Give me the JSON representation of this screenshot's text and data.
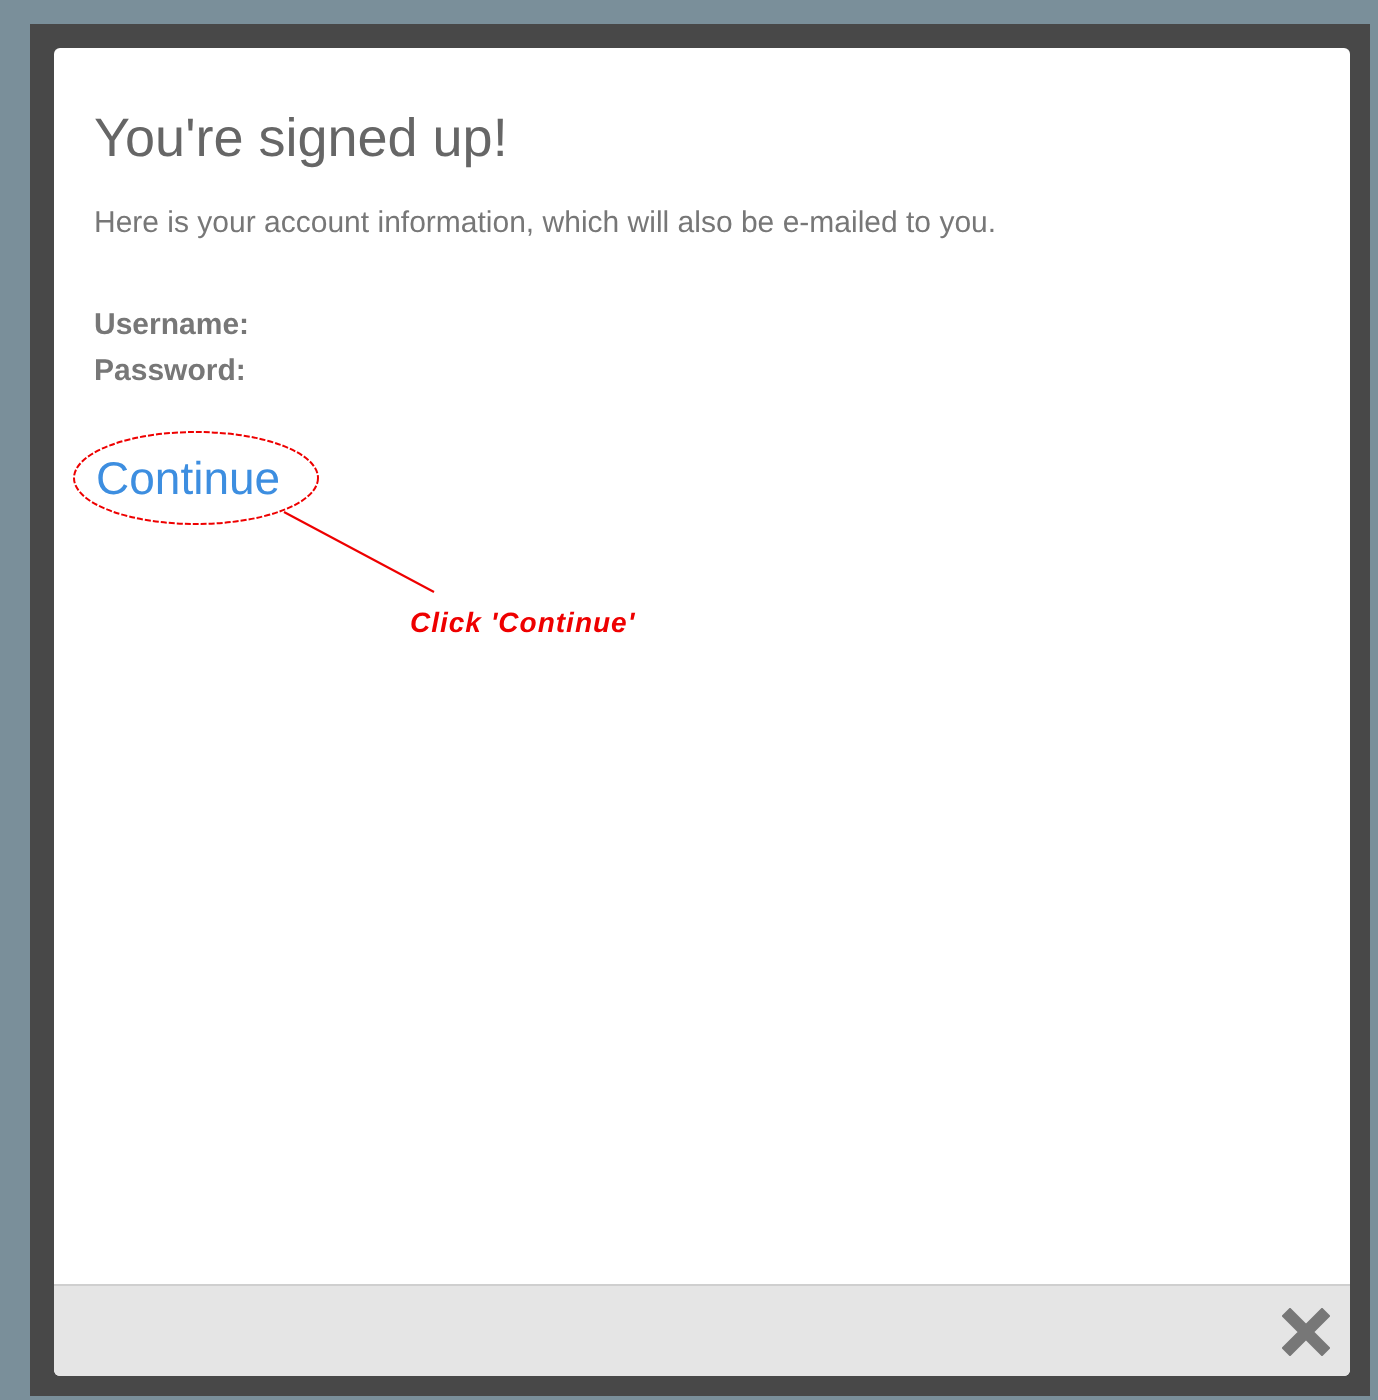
{
  "dialog": {
    "title": "You're signed up!",
    "message": "Here is your account information, which will also be e-mailed to you.",
    "fields": [
      {
        "label": "Username:"
      },
      {
        "label": "Password:"
      }
    ],
    "link": "Continue"
  },
  "annotation": {
    "text": "Click 'Continue'"
  }
}
